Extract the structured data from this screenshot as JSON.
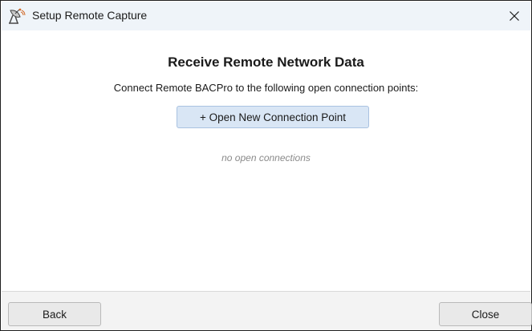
{
  "window": {
    "title": "Setup Remote Capture",
    "app_icon": "satellite-dish-icon",
    "close_icon": "close-icon"
  },
  "main": {
    "heading": "Receive Remote Network Data",
    "subheading": "Connect Remote BACPro to the following open connection points:",
    "open_button_label": "+ Open New Connection Point",
    "empty_message": "no open connections"
  },
  "footer": {
    "back_label": "Back",
    "close_label": "Close"
  },
  "colors": {
    "titlebar_bg": "#eff4f9",
    "primary_button_bg": "#d9e6f5",
    "footer_bg": "#f3f3f3",
    "muted_text": "#8a8a8a"
  }
}
